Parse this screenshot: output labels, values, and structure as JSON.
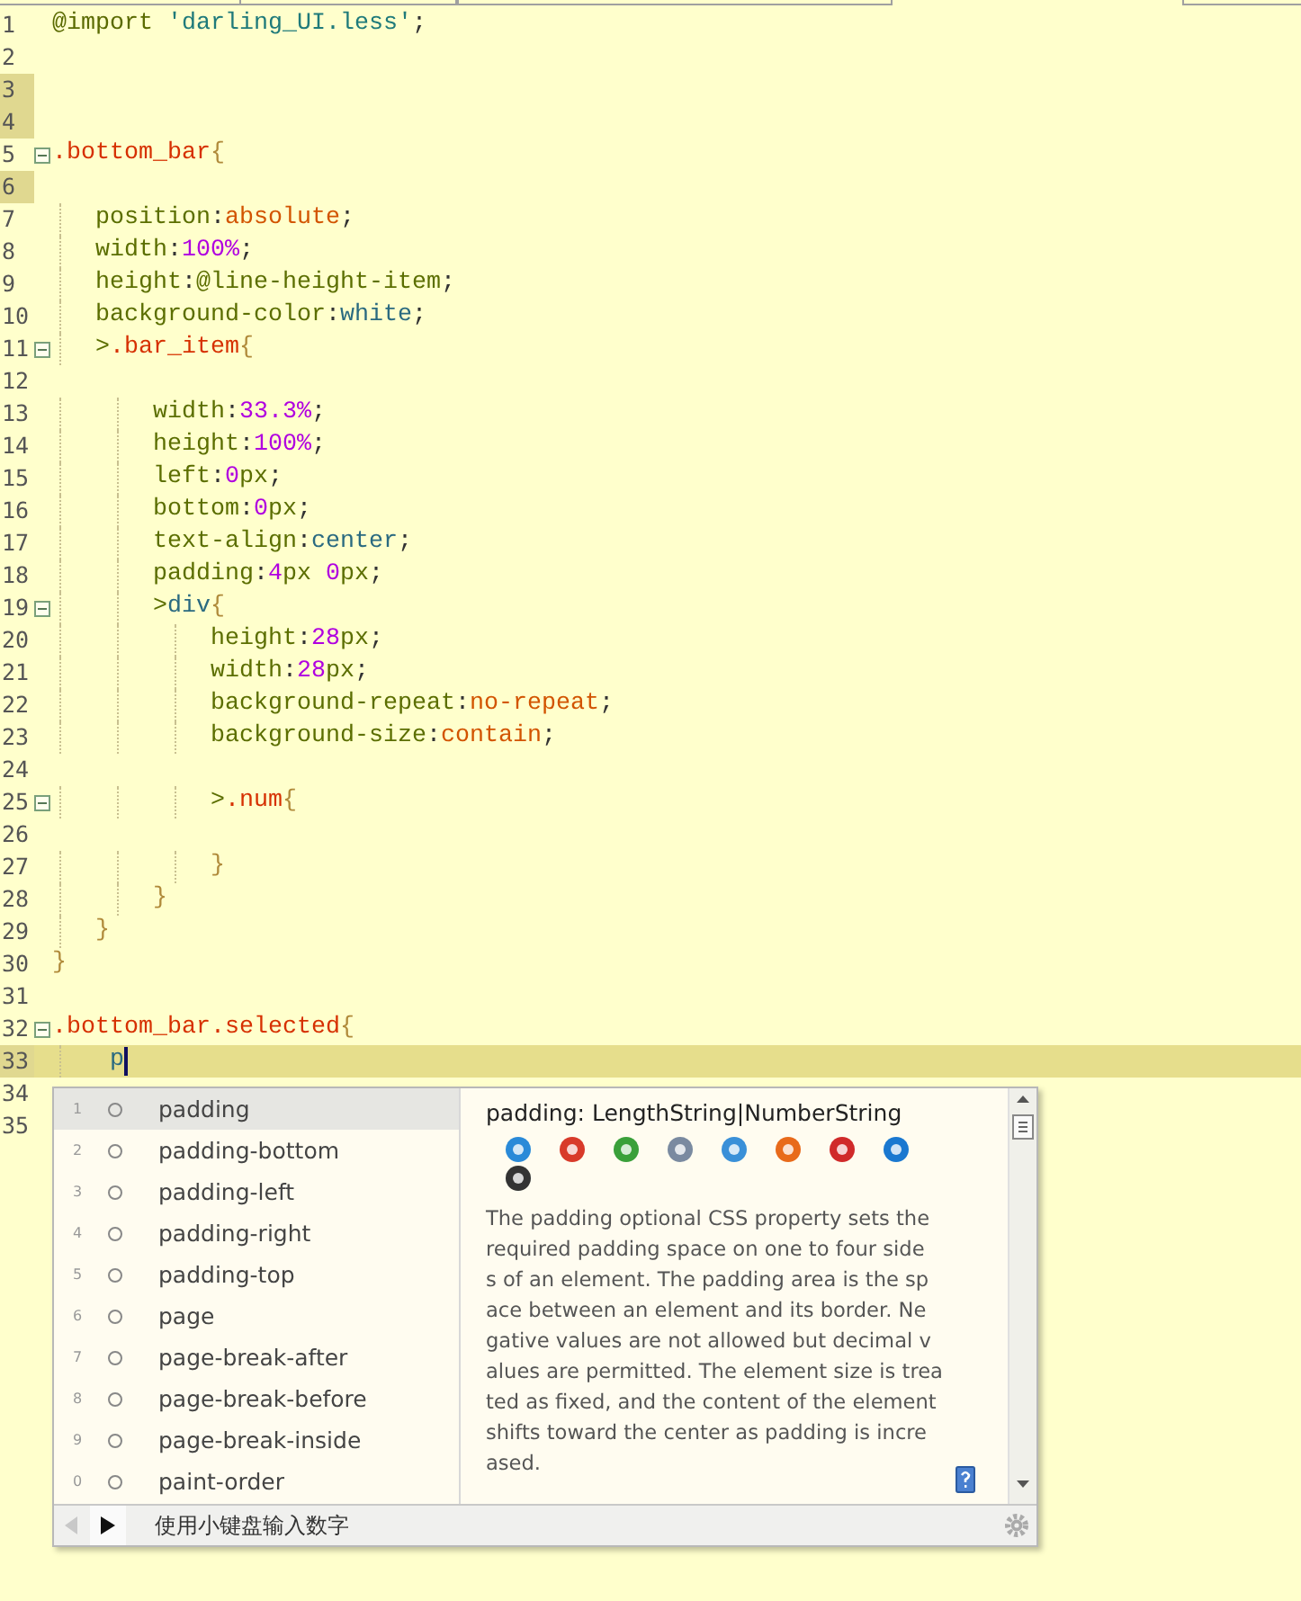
{
  "editor": {
    "lines": [
      {
        "number": "1",
        "marked": false,
        "fold": false,
        "current": false,
        "tokens": [
          {
            "kind": "kw",
            "text": "@import "
          },
          {
            "kind": "str",
            "text": "'darling_UI.less'"
          },
          {
            "kind": "punct",
            "text": ";"
          }
        ]
      },
      {
        "number": "2",
        "marked": false,
        "fold": false,
        "current": false
      },
      {
        "number": "3",
        "marked": true,
        "fold": false,
        "current": false
      },
      {
        "number": "4",
        "marked": true,
        "fold": false,
        "current": false
      },
      {
        "number": "5",
        "marked": false,
        "fold": true,
        "current": false,
        "tokens": [
          {
            "kind": "sel",
            "text": ".bottom_bar"
          },
          {
            "kind": "brace",
            "text": "{"
          }
        ]
      },
      {
        "number": "6",
        "marked": true,
        "fold": false,
        "current": false
      },
      {
        "number": "7",
        "marked": false,
        "fold": false,
        "current": false,
        "tokens": [
          {
            "kind": "prop",
            "text": "   position"
          },
          {
            "kind": "punct",
            "text": ":"
          },
          {
            "kind": "val",
            "text": "absolute"
          },
          {
            "kind": "punct",
            "text": ";"
          }
        ]
      },
      {
        "number": "8",
        "marked": false,
        "fold": false,
        "current": false,
        "tokens": [
          {
            "kind": "prop",
            "text": "   width"
          },
          {
            "kind": "punct",
            "text": ":"
          },
          {
            "kind": "num",
            "text": "100%"
          },
          {
            "kind": "punct",
            "text": ";"
          }
        ]
      },
      {
        "number": "9",
        "marked": false,
        "fold": false,
        "current": false,
        "tokens": [
          {
            "kind": "prop",
            "text": "   height"
          },
          {
            "kind": "punct",
            "text": ":"
          },
          {
            "kind": "prop",
            "text": "@line-height-item"
          },
          {
            "kind": "punct",
            "text": ";"
          }
        ]
      },
      {
        "number": "10",
        "marked": false,
        "fold": false,
        "current": false,
        "tokens": [
          {
            "kind": "prop",
            "text": "   background-color"
          },
          {
            "kind": "punct",
            "text": ":"
          },
          {
            "kind": "ident",
            "text": "white"
          },
          {
            "kind": "punct",
            "text": ";"
          }
        ]
      },
      {
        "number": "11",
        "marked": false,
        "fold": true,
        "current": false,
        "tokens": [
          {
            "kind": "prop",
            "text": "   >"
          },
          {
            "kind": "sel",
            "text": ".bar_item"
          },
          {
            "kind": "brace",
            "text": "{"
          }
        ]
      },
      {
        "number": "12",
        "marked": false,
        "fold": false,
        "current": false
      },
      {
        "number": "13",
        "marked": false,
        "fold": false,
        "current": false,
        "tokens": [
          {
            "kind": "prop",
            "text": "       width"
          },
          {
            "kind": "punct",
            "text": ":"
          },
          {
            "kind": "num",
            "text": "33.3%"
          },
          {
            "kind": "punct",
            "text": ";"
          }
        ]
      },
      {
        "number": "14",
        "marked": false,
        "fold": false,
        "current": false,
        "tokens": [
          {
            "kind": "prop",
            "text": "       height"
          },
          {
            "kind": "punct",
            "text": ":"
          },
          {
            "kind": "num",
            "text": "100%"
          },
          {
            "kind": "punct",
            "text": ";"
          }
        ]
      },
      {
        "number": "15",
        "marked": false,
        "fold": false,
        "current": false,
        "tokens": [
          {
            "kind": "prop",
            "text": "       left"
          },
          {
            "kind": "punct",
            "text": ":"
          },
          {
            "kind": "num",
            "text": "0"
          },
          {
            "kind": "unit",
            "text": "px"
          },
          {
            "kind": "punct",
            "text": ";"
          }
        ]
      },
      {
        "number": "16",
        "marked": false,
        "fold": false,
        "current": false,
        "tokens": [
          {
            "kind": "prop",
            "text": "       bottom"
          },
          {
            "kind": "punct",
            "text": ":"
          },
          {
            "kind": "num",
            "text": "0"
          },
          {
            "kind": "unit",
            "text": "px"
          },
          {
            "kind": "punct",
            "text": ";"
          }
        ]
      },
      {
        "number": "17",
        "marked": false,
        "fold": false,
        "current": false,
        "tokens": [
          {
            "kind": "prop",
            "text": "       text-align"
          },
          {
            "kind": "punct",
            "text": ":"
          },
          {
            "kind": "ident",
            "text": "center"
          },
          {
            "kind": "punct",
            "text": ";"
          }
        ]
      },
      {
        "number": "18",
        "marked": false,
        "fold": false,
        "current": false,
        "tokens": [
          {
            "kind": "prop",
            "text": "       padding"
          },
          {
            "kind": "punct",
            "text": ":"
          },
          {
            "kind": "num",
            "text": "4"
          },
          {
            "kind": "unit",
            "text": "px "
          },
          {
            "kind": "num",
            "text": "0"
          },
          {
            "kind": "unit",
            "text": "px"
          },
          {
            "kind": "punct",
            "text": ";"
          }
        ]
      },
      {
        "number": "19",
        "marked": false,
        "fold": true,
        "current": false,
        "tokens": [
          {
            "kind": "prop",
            "text": "       >"
          },
          {
            "kind": "ident",
            "text": "div"
          },
          {
            "kind": "brace",
            "text": "{"
          }
        ]
      },
      {
        "number": "20",
        "marked": false,
        "fold": false,
        "current": false,
        "tokens": [
          {
            "kind": "prop",
            "text": "           height"
          },
          {
            "kind": "punct",
            "text": ":"
          },
          {
            "kind": "num",
            "text": "28"
          },
          {
            "kind": "unit",
            "text": "px"
          },
          {
            "kind": "punct",
            "text": ";"
          }
        ]
      },
      {
        "number": "21",
        "marked": false,
        "fold": false,
        "current": false,
        "tokens": [
          {
            "kind": "prop",
            "text": "           width"
          },
          {
            "kind": "punct",
            "text": ":"
          },
          {
            "kind": "num",
            "text": "28"
          },
          {
            "kind": "unit",
            "text": "px"
          },
          {
            "kind": "punct",
            "text": ";"
          }
        ]
      },
      {
        "number": "22",
        "marked": false,
        "fold": false,
        "current": false,
        "tokens": [
          {
            "kind": "prop",
            "text": "           background-repeat"
          },
          {
            "kind": "punct",
            "text": ":"
          },
          {
            "kind": "val",
            "text": "no-repeat"
          },
          {
            "kind": "punct",
            "text": ";"
          }
        ]
      },
      {
        "number": "23",
        "marked": false,
        "fold": false,
        "current": false,
        "tokens": [
          {
            "kind": "prop",
            "text": "           background-size"
          },
          {
            "kind": "punct",
            "text": ":"
          },
          {
            "kind": "val",
            "text": "contain"
          },
          {
            "kind": "punct",
            "text": ";"
          }
        ]
      },
      {
        "number": "24",
        "marked": false,
        "fold": false,
        "current": false
      },
      {
        "number": "25",
        "marked": false,
        "fold": true,
        "current": false,
        "tokens": [
          {
            "kind": "prop",
            "text": "           >"
          },
          {
            "kind": "sel",
            "text": ".num"
          },
          {
            "kind": "brace",
            "text": "{"
          }
        ]
      },
      {
        "number": "26",
        "marked": false,
        "fold": false,
        "current": false
      },
      {
        "number": "27",
        "marked": false,
        "fold": false,
        "current": false,
        "tokens": [
          {
            "kind": "brace",
            "text": "           }"
          }
        ]
      },
      {
        "number": "28",
        "marked": false,
        "fold": false,
        "current": false,
        "tokens": [
          {
            "kind": "brace",
            "text": "       }"
          }
        ]
      },
      {
        "number": "29",
        "marked": false,
        "fold": false,
        "current": false,
        "tokens": [
          {
            "kind": "brace",
            "text": "   }"
          }
        ]
      },
      {
        "number": "30",
        "marked": false,
        "fold": false,
        "current": false,
        "tokens": [
          {
            "kind": "brace",
            "text": "}"
          }
        ]
      },
      {
        "number": "31",
        "marked": false,
        "fold": false,
        "current": false
      },
      {
        "number": "32",
        "marked": false,
        "fold": true,
        "current": false,
        "tokens": [
          {
            "kind": "sel",
            "text": ".bottom_bar.selected"
          },
          {
            "kind": "brace",
            "text": "{"
          }
        ]
      },
      {
        "number": "33",
        "marked": true,
        "fold": false,
        "current": true,
        "tokens": [
          {
            "kind": "ident",
            "text": "    p"
          }
        ]
      },
      {
        "number": "34",
        "marked": false,
        "fold": false,
        "current": false
      },
      {
        "number": "35",
        "marked": false,
        "fold": false,
        "current": false
      }
    ]
  },
  "autocomplete": {
    "items": [
      {
        "index": "1",
        "label": "padding",
        "selected": true
      },
      {
        "index": "2",
        "label": "padding-bottom",
        "selected": false
      },
      {
        "index": "3",
        "label": "padding-left",
        "selected": false
      },
      {
        "index": "4",
        "label": "padding-right",
        "selected": false
      },
      {
        "index": "5",
        "label": "padding-top",
        "selected": false
      },
      {
        "index": "6",
        "label": "page",
        "selected": false
      },
      {
        "index": "7",
        "label": "page-break-after",
        "selected": false
      },
      {
        "index": "8",
        "label": "page-break-before",
        "selected": false
      },
      {
        "index": "9",
        "label": "page-break-inside",
        "selected": false
      },
      {
        "index": "0",
        "label": "paint-order",
        "selected": false
      }
    ],
    "footer": "使用小键盘输入数字",
    "doc": {
      "title": "padding: LengthString|NumberString",
      "lines": [
        "The padding optional CSS property sets the",
        "required padding space on one to four side",
        "s of an element. The padding area is the sp",
        "ace between an element and its border. Ne",
        "gative values are not allowed but decimal v",
        "alues are permitted. The element size is trea",
        "ted as fixed, and the content of the element",
        "shifts toward the center as padding is incre",
        "ased."
      ]
    }
  }
}
